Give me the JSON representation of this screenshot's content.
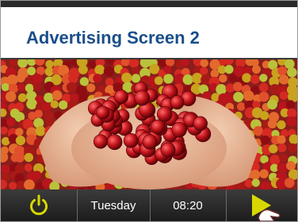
{
  "screen": {
    "title": "Advertising Screen 2"
  },
  "image": {
    "subject": "hands-holding-red-coffee-cherries"
  },
  "statusbar": {
    "day": "Tuesday",
    "time": "08:20",
    "power_icon": "power-icon",
    "next_icon": "next-arrow-icon"
  },
  "colors": {
    "title": "#1a4e8a",
    "accent_icon": "#d8d800",
    "bar": "#2a2a2a"
  }
}
